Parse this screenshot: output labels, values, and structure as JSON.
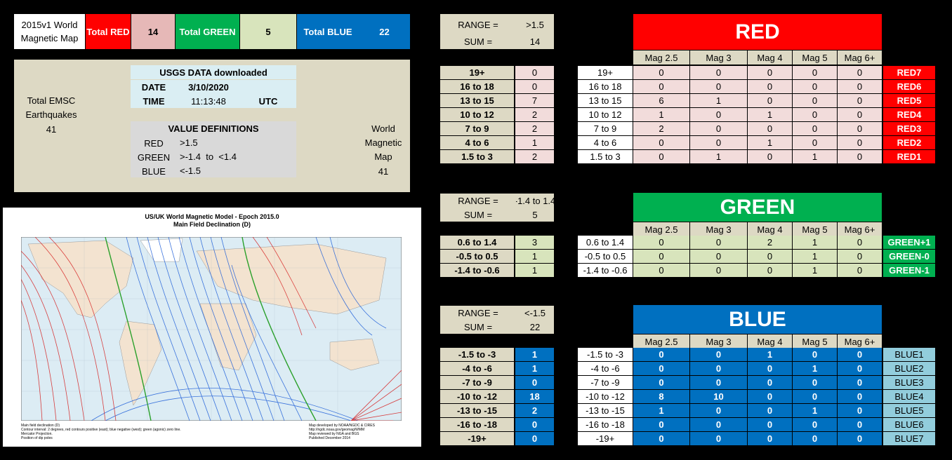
{
  "summary": {
    "title": "2015v1 World Magnetic Map",
    "total_red_label": "Total RED",
    "total_red_value": "14",
    "total_green_label": "Total GREEN",
    "total_green_value": "5",
    "total_blue_label": "Total BLUE",
    "total_blue_value": "22"
  },
  "info": {
    "total_emsc_label": "Total EMSC Earthquakes",
    "total_emsc_value": "41",
    "usgs_header": "USGS DATA downloaded",
    "date_label": "DATE",
    "date_value": "3/10/2020",
    "time_label": "TIME",
    "time_value": "11:13:48",
    "tz": "UTC",
    "defs_header": "VALUE DEFINITIONS",
    "defs": [
      {
        "name": "RED",
        "value": ">1.5"
      },
      {
        "name": "GREEN",
        "value": ">-1.4  to  <1.4"
      },
      {
        "name": "BLUE",
        "value": "<-1.5"
      }
    ],
    "world_map_label": "World Magnetic Map",
    "world_map_value": "41"
  },
  "map": {
    "title_line1": "US/UK World Magnetic Model - Epoch 2015.0",
    "title_line2": "Main Field Declination (D)",
    "footer_left": [
      "Main field declination (D)",
      "Contour interval: 2 degrees, red contours positive (east); blue negative (west); green (agonic) zero line.",
      "Mercator Projection.",
      "Position of dip poles"
    ],
    "footer_right": [
      "Map developed by NOAA/NGDC & CIRES",
      "http://ngdc.noaa.gov/geomag/WMM",
      "Map reviewed by NGA and BGS",
      "Published December 2014"
    ]
  },
  "colors": {
    "red": "#ff0000",
    "green": "#00b050",
    "blue": "#0070c0",
    "pink": "#f2dcdb",
    "light_green": "#d8e4bc",
    "light_blue": "#92cddc",
    "tan": "#ddd9c4"
  },
  "mag_headers": [
    "Mag 2.5",
    "Mag 3",
    "Mag 4",
    "Mag 5",
    "Mag 6+"
  ],
  "red": {
    "range_label": "RANGE =",
    "range_value": ">1.5",
    "sum_label": "SUM =",
    "sum_value": "14",
    "banner": "RED",
    "rows": [
      {
        "range": "19+",
        "count": "0",
        "mags": [
          "0",
          "0",
          "0",
          "0",
          "0"
        ],
        "tag": "RED7"
      },
      {
        "range": "16 to 18",
        "count": "0",
        "mags": [
          "0",
          "0",
          "0",
          "0",
          "0"
        ],
        "tag": "RED6"
      },
      {
        "range": "13 to 15",
        "count": "7",
        "mags": [
          "6",
          "1",
          "0",
          "0",
          "0"
        ],
        "tag": "RED5"
      },
      {
        "range": "10 to 12",
        "count": "2",
        "mags": [
          "1",
          "0",
          "1",
          "0",
          "0"
        ],
        "tag": "RED4"
      },
      {
        "range": "7 to 9",
        "count": "2",
        "mags": [
          "2",
          "0",
          "0",
          "0",
          "0"
        ],
        "tag": "RED3"
      },
      {
        "range": "4 to 6",
        "count": "1",
        "mags": [
          "0",
          "0",
          "1",
          "0",
          "0"
        ],
        "tag": "RED2"
      },
      {
        "range": "1.5 to 3",
        "count": "2",
        "mags": [
          "0",
          "1",
          "0",
          "1",
          "0"
        ],
        "tag": "RED1"
      }
    ]
  },
  "green": {
    "range_label": "RANGE =",
    "range_value": "-1.4 to 1.4",
    "sum_label": "SUM =",
    "sum_value": "5",
    "banner": "GREEN",
    "rows": [
      {
        "range": "0.6 to 1.4",
        "count": "3",
        "mags": [
          "0",
          "0",
          "2",
          "1",
          "0"
        ],
        "tag": "GREEN+1"
      },
      {
        "range": "-0.5 to 0.5",
        "count": "1",
        "mags": [
          "0",
          "0",
          "0",
          "1",
          "0"
        ],
        "tag": "GREEN-0"
      },
      {
        "range": "-1.4 to -0.6",
        "count": "1",
        "mags": [
          "0",
          "0",
          "0",
          "1",
          "0"
        ],
        "tag": "GREEN-1"
      }
    ]
  },
  "blue": {
    "range_label": "RANGE =",
    "range_value": "<-1.5",
    "sum_label": "SUM =",
    "sum_value": "22",
    "banner": "BLUE",
    "rows": [
      {
        "range": "-1.5 to -3",
        "count": "1",
        "mags": [
          "0",
          "0",
          "1",
          "0",
          "0"
        ],
        "tag": "BLUE1"
      },
      {
        "range": "-4 to -6",
        "count": "1",
        "mags": [
          "0",
          "0",
          "0",
          "1",
          "0"
        ],
        "tag": "BLUE2"
      },
      {
        "range": "-7 to -9",
        "count": "0",
        "mags": [
          "0",
          "0",
          "0",
          "0",
          "0"
        ],
        "tag": "BLUE3"
      },
      {
        "range": "-10 to -12",
        "count": "18",
        "mags": [
          "8",
          "10",
          "0",
          "0",
          "0"
        ],
        "tag": "BLUE4"
      },
      {
        "range": "-13 to -15",
        "count": "2",
        "mags": [
          "1",
          "0",
          "0",
          "1",
          "0"
        ],
        "tag": "BLUE5"
      },
      {
        "range": "-16 to -18",
        "count": "0",
        "mags": [
          "0",
          "0",
          "0",
          "0",
          "0"
        ],
        "tag": "BLUE6"
      },
      {
        "range": "-19+",
        "count": "0",
        "mags": [
          "0",
          "0",
          "0",
          "0",
          "0"
        ],
        "tag": "BLUE7"
      }
    ]
  }
}
